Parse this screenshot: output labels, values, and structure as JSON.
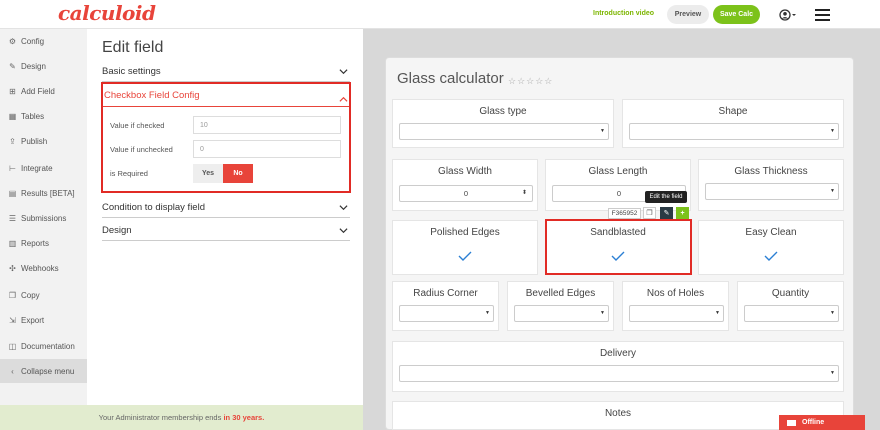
{
  "header": {
    "logo": "calculoid",
    "intro_link": "Introduction video",
    "preview_label": "Preview",
    "save_label": "Save Calc"
  },
  "sidebar": {
    "items": [
      {
        "label": "Config",
        "icon": "gear-icon"
      },
      {
        "label": "Design",
        "icon": "brush-icon"
      },
      {
        "label": "Add Field",
        "icon": "plus-icon"
      },
      {
        "label": "Tables",
        "icon": "table-icon"
      },
      {
        "label": "Publish",
        "icon": "upload-icon"
      },
      {
        "label": "Integrate",
        "icon": "code-icon"
      },
      {
        "label": "Results [BETA]",
        "icon": "chart-icon"
      },
      {
        "label": "Submissions",
        "icon": "list-icon"
      },
      {
        "label": "Reports",
        "icon": "bar-chart-icon"
      },
      {
        "label": "Webhooks",
        "icon": "webhook-icon"
      },
      {
        "label": "Copy",
        "icon": "copy-icon"
      },
      {
        "label": "Export",
        "icon": "export-icon"
      },
      {
        "label": "Documentation",
        "icon": "book-icon"
      },
      {
        "label": "Collapse menu",
        "icon": "chevron-left-icon"
      }
    ]
  },
  "edit_panel": {
    "title": "Edit field",
    "basic_settings": "Basic settings",
    "checkbox_config": {
      "title": "Checkbox Field Config",
      "value_checked_label": "Value if checked",
      "value_checked": "10",
      "value_unchecked_label": "Value if unchecked",
      "value_unchecked": "0",
      "required_label": "is Required",
      "yes_label": "Yes",
      "no_label": "No"
    },
    "condition": "Condition to display field",
    "design": "Design"
  },
  "membership": {
    "text": "Your Administrator membership ends",
    "highlight": "in 30 years."
  },
  "calculator": {
    "title": "Glass calculator",
    "stars": "☆☆☆☆☆",
    "fields": {
      "glass_type": "Glass type",
      "shape": "Shape",
      "glass_width": "Glass Width",
      "glass_width_value": "0",
      "glass_length": "Glass Length",
      "glass_length_value": "0",
      "glass_thickness": "Glass Thickness",
      "polished_edges": "Polished Edges",
      "sandblasted": "Sandblasted",
      "easy_clean": "Easy Clean",
      "radius_corner": "Radius Corner",
      "bevelled_edges": "Bevelled Edges",
      "nos_of_holes": "Nos of Holes",
      "quantity": "Quantity",
      "delivery": "Delivery",
      "notes": "Notes"
    },
    "field_tools": {
      "field_id": "F365952",
      "tooltip": "Edit the field"
    }
  },
  "chat": {
    "status": "Offline"
  },
  "colors": {
    "brand_red": "#e8443a",
    "save_green": "#7cc21a",
    "check_blue": "#2b7fd4",
    "membership_bg": "#e2eccf"
  }
}
